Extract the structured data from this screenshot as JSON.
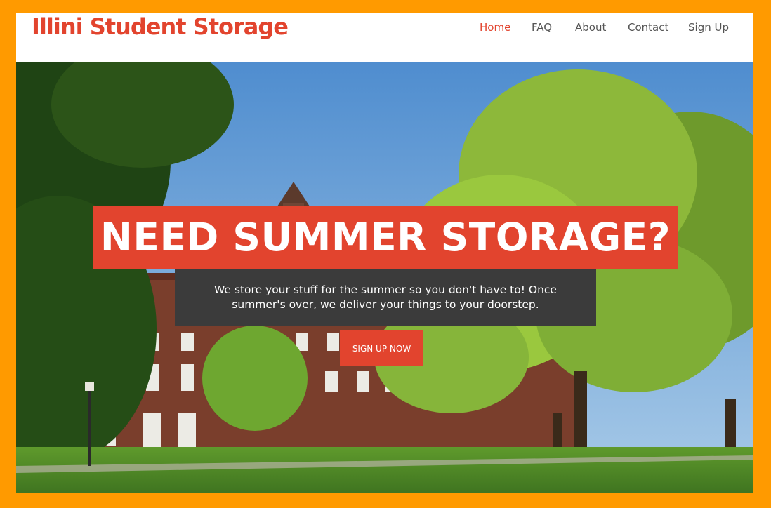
{
  "brand": {
    "name": "Illini Student Storage"
  },
  "nav": {
    "items": [
      {
        "label": "Home",
        "active": true
      },
      {
        "label": "FAQ"
      },
      {
        "label": "About"
      },
      {
        "label": "Contact"
      },
      {
        "label": "Sign Up"
      }
    ]
  },
  "hero": {
    "headline": "NEED SUMMER STORAGE?",
    "subtext": "We store your stuff for the summer so you don't have to! Once summer's over, we deliver your things to your doorstep.",
    "cta_label": "SIGN UP NOW"
  },
  "colors": {
    "page_border": "#ff9a00",
    "accent": "#e2442e",
    "nav_text": "#555555",
    "subbox_bg": "#3b3b3b"
  }
}
